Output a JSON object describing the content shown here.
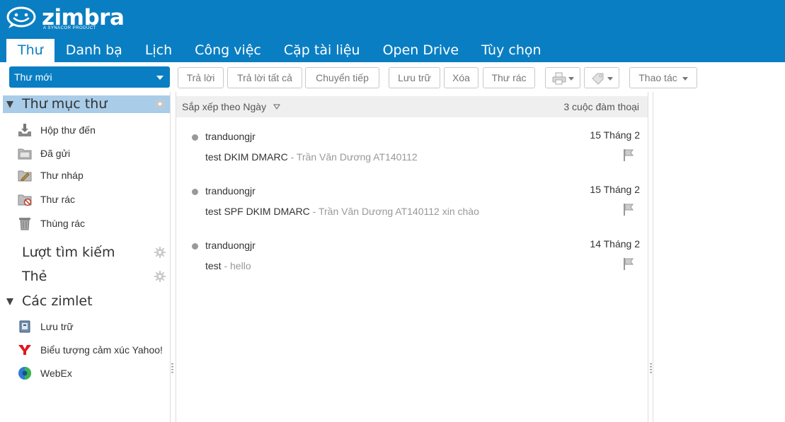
{
  "brand": {
    "name": "zimbra",
    "tagline": "A SYNACOR PRODUCT",
    "header_color": "#0a7ec2"
  },
  "tabs": [
    {
      "label": "Thư",
      "active": true
    },
    {
      "label": "Danh bạ"
    },
    {
      "label": "Lịch"
    },
    {
      "label": "Công việc"
    },
    {
      "label": "Cặp tài liệu"
    },
    {
      "label": "Open Drive"
    },
    {
      "label": "Tùy chọn"
    }
  ],
  "toolbar": {
    "new_mail": "Thư mới",
    "reply": "Trả lời",
    "reply_all": "Trả lời tất cả",
    "forward": "Chuyển tiếp",
    "archive": "Lưu trữ",
    "delete": "Xóa",
    "spam": "Thư rác",
    "actions": "Thao tác",
    "print_icon": "print-icon",
    "tag_icon": "tag-icon"
  },
  "sidebar": {
    "folders_title": "Thư mục thư",
    "folders": [
      {
        "label": "Hộp thư đến",
        "icon": "inbox-icon"
      },
      {
        "label": "Đã gửi",
        "icon": "sent-icon"
      },
      {
        "label": "Thư nháp",
        "icon": "drafts-icon"
      },
      {
        "label": "Thư rác",
        "icon": "junk-icon"
      },
      {
        "label": "Thùng rác",
        "icon": "trash-icon"
      }
    ],
    "searches_title": "Lượt tìm kiếm",
    "tags_title": "Thẻ",
    "zimlets_title": "Các zimlet",
    "zimlets": [
      {
        "label": "Lưu trữ",
        "icon": "archive-zimlet-icon"
      },
      {
        "label": "Biểu tượng cảm xúc Yahoo!",
        "icon": "yahoo-icon"
      },
      {
        "label": "WebEx",
        "icon": "webex-icon"
      }
    ]
  },
  "list": {
    "sort_label": "Sắp xếp theo Ngày",
    "count_label": "3 cuộc đàm thoại",
    "messages": [
      {
        "sender": "tranduongjr",
        "date": "15 Tháng 2",
        "subject": "test DKIM DMARC",
        "fragment": " - Trần Văn Dương AT140112"
      },
      {
        "sender": "tranduongjr",
        "date": "15 Tháng 2",
        "subject": "test SPF DKIM DMARC",
        "fragment": " - Trần Văn Dương AT140112 xin chào"
      },
      {
        "sender": "tranduongjr",
        "date": "14 Tháng 2",
        "subject": "test",
        "fragment": " - hello"
      }
    ]
  }
}
